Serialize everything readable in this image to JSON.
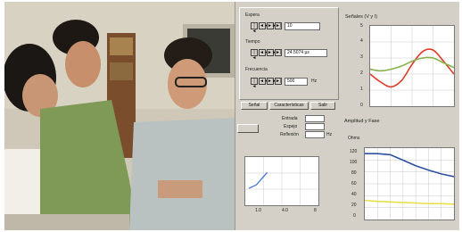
{
  "app": {
    "controls": [
      {
        "label": "Espera",
        "value": "10",
        "unit": ""
      },
      {
        "label": "Tiempo",
        "value": "24.5074 µs",
        "unit": ""
      },
      {
        "label": "Frecuencia",
        "value": "500",
        "unit": "Hz"
      }
    ],
    "transport_buttons": [
      "|◄",
      "◄◄",
      "►►",
      "►|"
    ],
    "tabs": [
      "Señal",
      "Características",
      "Salir"
    ],
    "side_panel": {
      "fields": [
        {
          "label": "Entrada",
          "value": ""
        },
        {
          "label": "Espejo",
          "value": ""
        },
        {
          "label": "Reflexión",
          "value": "",
          "unit": "Hz"
        }
      ]
    },
    "top_chart": {
      "title": "Señales (V y I)"
    },
    "bottom_chart": {
      "title": "Amplitud y Fase",
      "subtitle": "Ohms"
    }
  },
  "chart_data": [
    {
      "type": "line",
      "title": "Señales (V y I)",
      "ylim": [
        0,
        5
      ],
      "yticks": [
        "5",
        "4",
        "3",
        "2",
        "1",
        "0"
      ],
      "series": [
        {
          "color": "#e03a2a",
          "values": [
            2.0,
            1.5,
            1.2,
            1.6,
            2.6,
            3.4,
            3.5,
            2.8,
            2.0
          ]
        },
        {
          "color": "#86b24a",
          "values": [
            2.3,
            2.2,
            2.3,
            2.5,
            2.8,
            3.0,
            3.0,
            2.7,
            2.4
          ]
        }
      ]
    },
    {
      "type": "line",
      "title": "Amplitud y Fase",
      "ylabel": "Ohms",
      "yticks": [
        "120",
        "100",
        "80",
        "60",
        "40",
        "20",
        "0"
      ],
      "ylim": [
        0,
        130
      ],
      "series": [
        {
          "color": "#2f4fa0",
          "values": [
            120,
            120,
            118,
            108,
            98,
            90,
            83,
            78
          ]
        },
        {
          "color": "#e6e04a",
          "values": [
            35,
            33,
            32,
            31,
            30,
            29,
            29,
            28
          ]
        }
      ]
    },
    {
      "type": "line",
      "xticks": [
        "1.0",
        "4.0",
        "8"
      ],
      "xlim": [
        0,
        8
      ],
      "ylim": [
        0,
        1
      ],
      "series": [
        {
          "color": "#3a6fd6",
          "points": [
            [
              0.4,
              0.35
            ],
            [
              1.2,
              0.42
            ],
            [
              1.8,
              0.55
            ],
            [
              2.4,
              0.68
            ]
          ]
        }
      ]
    }
  ]
}
